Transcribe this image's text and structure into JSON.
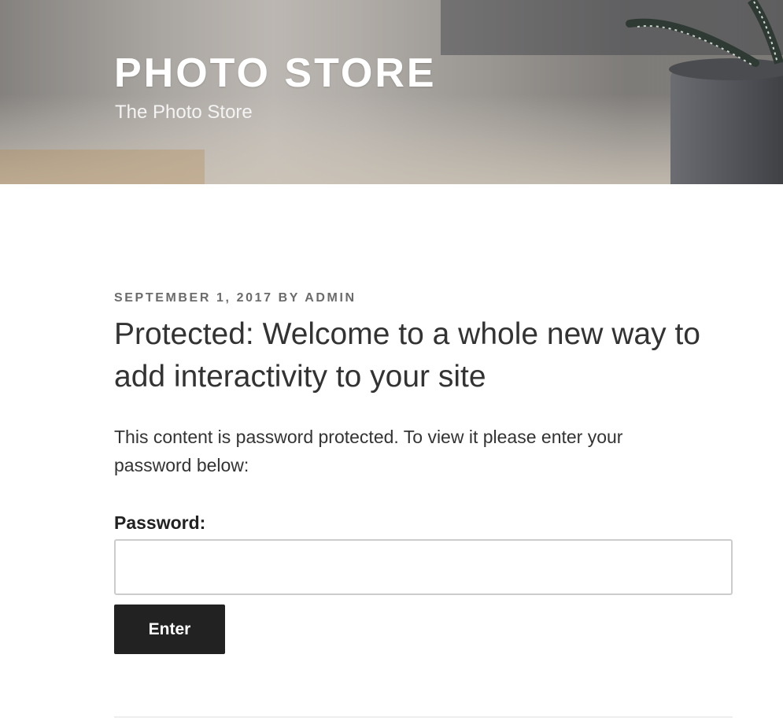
{
  "header": {
    "site_title": "PHOTO STORE",
    "site_description": "The Photo Store"
  },
  "post": {
    "meta": "SEPTEMBER 1, 2017 BY ADMIN",
    "title": "Protected: Welcome to a whole new way to add interactivity to your site",
    "notice": "This content is password protected. To view it please enter your password below:"
  },
  "password_form": {
    "label": "Password:",
    "input_value": "",
    "submit_label": "Enter"
  },
  "colors": {
    "button_bg": "#222222",
    "meta_text": "#6b6b6b",
    "body_text": "#333333"
  }
}
